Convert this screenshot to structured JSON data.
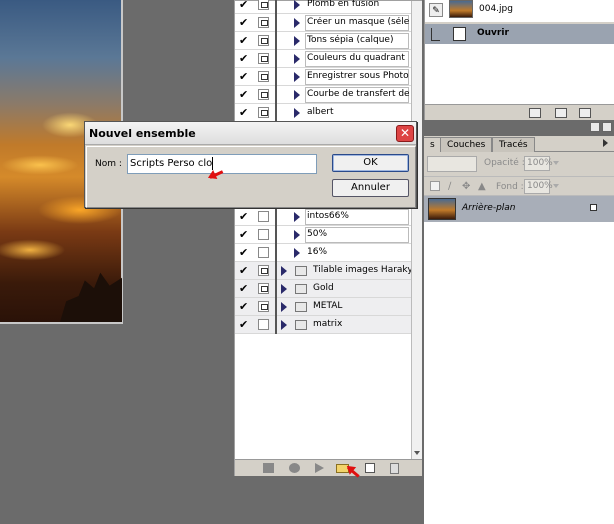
{
  "actions": {
    "rows": [
      {
        "label": "Plomb en fusion",
        "checked": "✔",
        "type": "action"
      },
      {
        "label": "Créer un masque (sélec...",
        "checked": "✔",
        "type": "action"
      },
      {
        "label": "Tons sépia (calque)",
        "checked": "✔",
        "type": "action"
      },
      {
        "label": "Couleurs du quadrant",
        "checked": "✔",
        "type": "action"
      },
      {
        "label": "Enregistrer sous Photo...",
        "checked": "✔",
        "type": "action"
      },
      {
        "label": "Courbe de transfert de ...",
        "checked": "✔",
        "type": "action"
      },
      {
        "label": "albert",
        "checked": "✔",
        "type": "action"
      }
    ],
    "rows_bottom": [
      {
        "label": "intos66%",
        "checked": "✔",
        "type": "action"
      },
      {
        "label": "50%",
        "checked": "✔",
        "type": "action"
      },
      {
        "label": "16%",
        "checked": "✔",
        "type": "action"
      },
      {
        "label": "Tilable images Harakys",
        "checked": "✔",
        "type": "set"
      },
      {
        "label": "Gold",
        "checked": "✔",
        "type": "set"
      },
      {
        "label": "METAL",
        "checked": "✔",
        "type": "set"
      },
      {
        "label": "matrix",
        "checked": "✔",
        "type": "set"
      }
    ]
  },
  "history": {
    "snapshot_name": "004.jpg",
    "state_name": "Ouvrir"
  },
  "layers": {
    "tabs": [
      "s",
      "Couches",
      "Tracés"
    ],
    "opacity_label": "Opacité :",
    "opacity_value": "100%",
    "fill_label": "Fond :",
    "fill_value": "100%",
    "layer_name": "Arrière-plan"
  },
  "dialog": {
    "title": "Nouvel ensemble",
    "name_label": "Nom :",
    "name_value": "Scripts Perso clo",
    "ok_label": "OK",
    "cancel_label": "Annuler",
    "close_glyph": "✕"
  },
  "colors": {
    "accent_arrow": "#e01010",
    "selection": "#a8aeb8",
    "dialog_close": "#dd4444"
  }
}
